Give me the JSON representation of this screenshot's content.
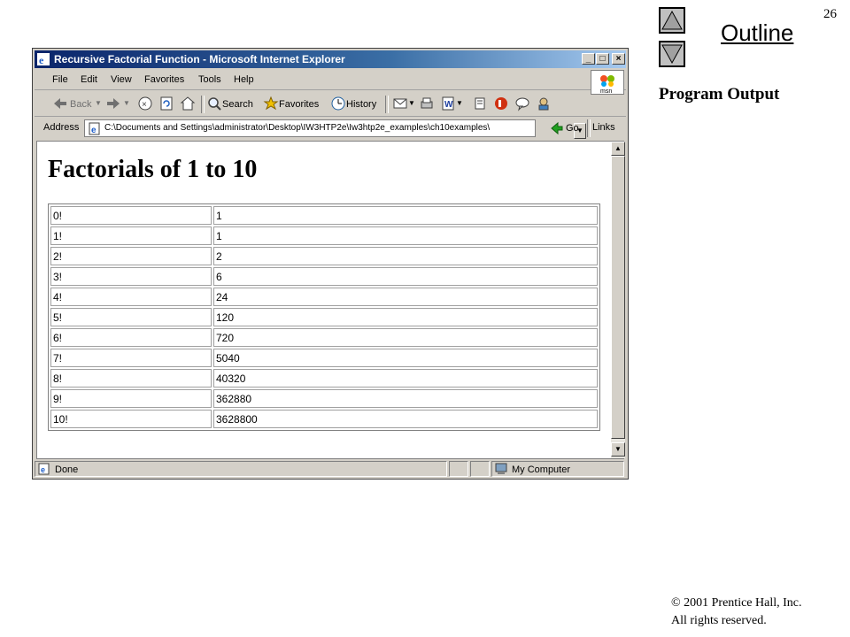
{
  "slide": {
    "page_number": "26",
    "outline_label": "Outline",
    "section_label": "Program Output",
    "copyright_line1": "© 2001 Prentice Hall, Inc.",
    "copyright_line2": "All rights reserved."
  },
  "window": {
    "title": "Recursive Factorial Function - Microsoft Internet Explorer",
    "controls": {
      "minimize": "_",
      "maximize": "□",
      "close": "×"
    }
  },
  "menu": [
    "File",
    "Edit",
    "View",
    "Favorites",
    "Tools",
    "Help"
  ],
  "toolbar": {
    "back_label": "Back",
    "search_label": "Search",
    "favorites_label": "Favorites",
    "history_label": "History"
  },
  "address": {
    "label": "Address",
    "value": "C:\\Documents and Settings\\administrator\\Desktop\\IW3HTP2e\\Iw3htp2e_examples\\ch10examples\\",
    "go_label": "Go",
    "links_label": "Links"
  },
  "content": {
    "heading": "Factorials of 1 to 10",
    "rows": [
      [
        "0!",
        "1"
      ],
      [
        "1!",
        "1"
      ],
      [
        "2!",
        "2"
      ],
      [
        "3!",
        "6"
      ],
      [
        "4!",
        "24"
      ],
      [
        "5!",
        "120"
      ],
      [
        "6!",
        "720"
      ],
      [
        "7!",
        "5040"
      ],
      [
        "8!",
        "40320"
      ],
      [
        "9!",
        "362880"
      ],
      [
        "10!",
        "3628800"
      ]
    ]
  },
  "status": {
    "text": "Done",
    "zone": "My Computer"
  },
  "colors": {
    "titlebar": "#0a246a",
    "chrome": "#d4d0c8"
  }
}
